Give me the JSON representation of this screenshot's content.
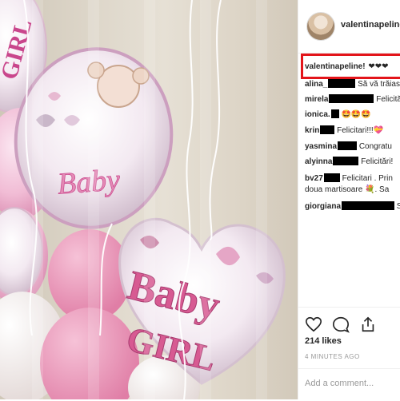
{
  "header": {
    "username": "valentinapeline"
  },
  "caption": {
    "username": "valentinapeline!",
    "hearts": "❤❤❤"
  },
  "comments": [
    {
      "user": "alina_",
      "text": "Să vă trăias"
    },
    {
      "user": "mirela",
      "text": "Felicită"
    },
    {
      "user": "ionica.",
      "text": "🤩🤩🤩"
    },
    {
      "user": "krin",
      "text": "Felicitari!!!💝"
    },
    {
      "user": "yasmina",
      "text": "Congratu"
    },
    {
      "user": "alyinna",
      "text": "Felicitări!"
    },
    {
      "user": "bv27",
      "text": "Felicitari . Prin",
      "text2": "doua martisoare 💐. Sa"
    },
    {
      "user": "giorgiana",
      "text": "S"
    }
  ],
  "balloons": {
    "baby": "Baby",
    "girl": "GIRL",
    "baby_big": "Baby",
    "girl_big": "GIRL"
  },
  "actions": {
    "likes": "214 likes",
    "time": "4 MINUTES AGO",
    "add_comment_placeholder": "Add a comment..."
  },
  "colors": {
    "highlight": "#e3151a",
    "pink": "#e38fb4",
    "balloon_text": "#c9468c"
  },
  "icons": [
    "heart-icon",
    "comment-icon",
    "share-icon"
  ]
}
